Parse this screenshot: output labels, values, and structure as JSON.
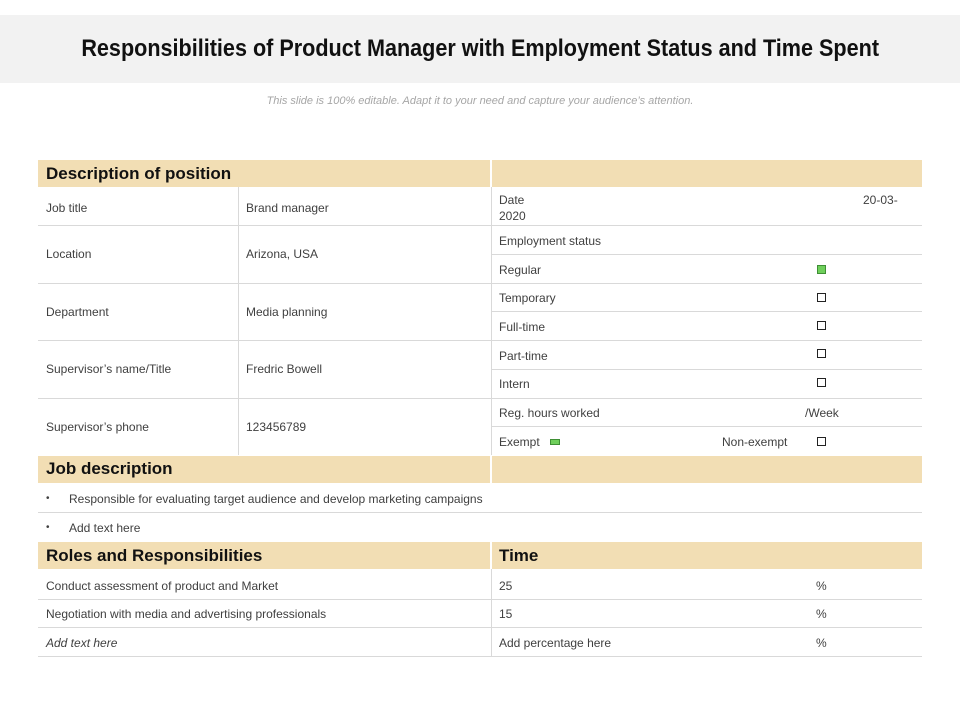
{
  "header": {
    "title": "Responsibilities of Product Manager with Employment Status and Time Spent",
    "subtitle": "This slide is 100% editable. Adapt it to your need and capture your audience’s attention."
  },
  "position": {
    "heading": "Description of position",
    "rows": [
      {
        "label": "Job title",
        "value": "Brand manager"
      },
      {
        "label": "Location",
        "value": "Arizona, USA"
      },
      {
        "label": "Department",
        "value": "Media planning"
      },
      {
        "label": "Supervisor’s name/Title",
        "value": "Fredric Bowell"
      },
      {
        "label": "Supervisor’s phone",
        "value": "123456789"
      }
    ]
  },
  "status": {
    "date_label": "Date",
    "date_value_part1": "20-03-",
    "date_value_part2": "2020",
    "employment_status_label": "Employment status",
    "options": [
      {
        "label": "Regular",
        "checked": true
      },
      {
        "label": "Temporary",
        "checked": false
      },
      {
        "label": "Full-time",
        "checked": false
      },
      {
        "label": "Part-time",
        "checked": false
      },
      {
        "label": "Intern",
        "checked": false
      }
    ],
    "hours_label": "Reg.  hours worked",
    "hours_unit": "/Week",
    "exempt_label": "Exempt",
    "exempt_checked": true,
    "non_exempt_label": "Non-exempt",
    "non_exempt_checked": false
  },
  "job_description": {
    "heading": "Job description",
    "bullet": "•",
    "items": [
      "Responsible for evaluating target audience and develop marketing campaigns",
      "Add text here"
    ]
  },
  "roles": {
    "heading": "Roles and Responsibilities",
    "time_heading": "Time",
    "rows": [
      {
        "role": "Conduct assessment of product and Market",
        "time": "25",
        "unit": "%"
      },
      {
        "role": "Negotiation with media and advertising professionals",
        "time": "15",
        "unit": "%"
      },
      {
        "role": "Add text here",
        "time": "Add percentage here",
        "unit": "%"
      }
    ]
  },
  "colors": {
    "band": "#f2deb4",
    "checked": "#6fcf5b",
    "title_bar": "#f2f2f2"
  }
}
